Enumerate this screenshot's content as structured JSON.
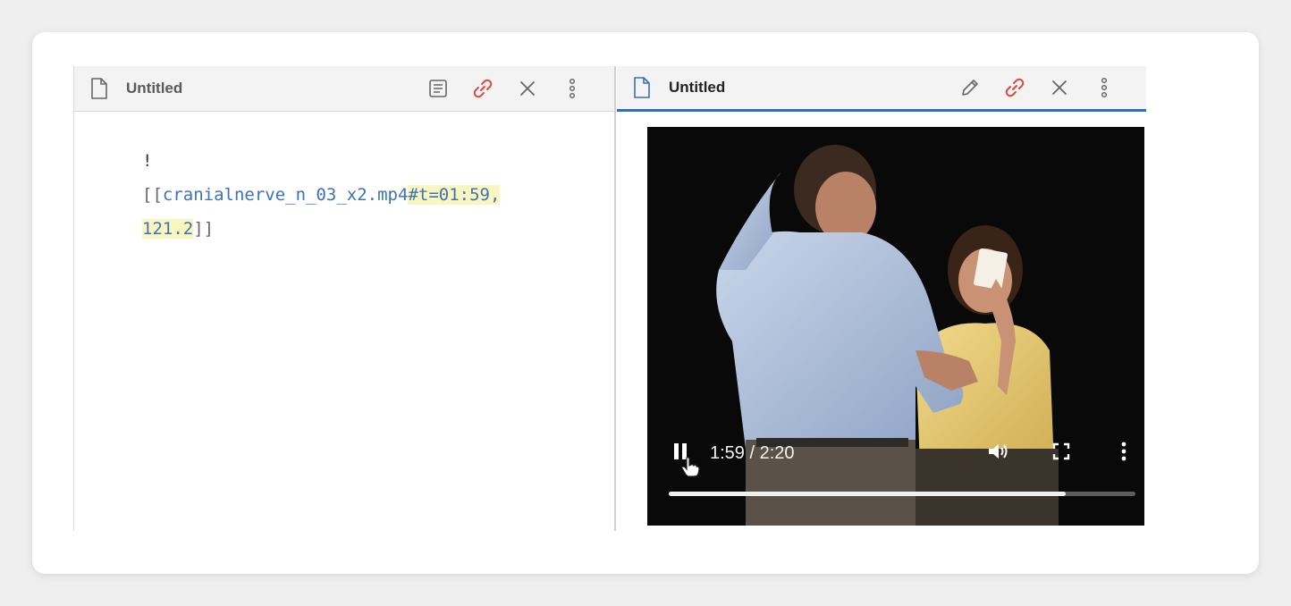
{
  "left_pane": {
    "title": "Untitled",
    "editor": {
      "line1": "!",
      "line2_open": "[[",
      "line2_link": "cranialnerve_n_03_x2.mp4",
      "line2_fragment": "#t=01:59,",
      "line3_fragment": "121.2",
      "line3_close": "]]"
    },
    "actions": [
      "reading-view-icon",
      "link-icon",
      "close-icon",
      "more-options-icon"
    ]
  },
  "right_pane": {
    "title": "Untitled",
    "actions": [
      "edit-pencil-icon",
      "link-icon",
      "close-icon",
      "more-options-icon"
    ],
    "video": {
      "time_display": "1:59 / 2:20",
      "progress": 0.85,
      "state": "playing"
    }
  },
  "colors": {
    "accent": "#2f6fc2",
    "link": "#3d72b8",
    "link_icon": "#e0483f",
    "highlight": "#fbf6c0"
  }
}
